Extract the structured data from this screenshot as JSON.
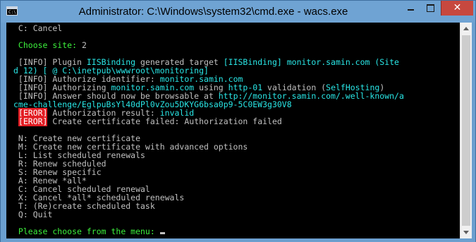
{
  "window": {
    "title": "Administrator: C:\\Windows\\system32\\cmd.exe - wacs.exe",
    "app_icon": "console-icon",
    "controls": {
      "minimize_icon": "minimize-icon",
      "maximize_icon": "maximize-icon",
      "close_icon": "close-icon",
      "close_glyph": "✕"
    }
  },
  "colors": {
    "titlebar": "#6fa3d3",
    "console_bg": "#000000",
    "text": "#c0c0c0",
    "green": "#3cf03c",
    "cyan": "#29e6e6",
    "error_bg": "#e31c23",
    "close_button": "#c7483f"
  },
  "console": {
    "lines": [
      [
        {
          "t": " C: Cancel",
          "c": "w"
        }
      ],
      [
        {
          "t": "",
          "c": "w"
        }
      ],
      [
        {
          "t": " Choose site: ",
          "c": "g"
        },
        {
          "t": "2",
          "c": "w"
        }
      ],
      [
        {
          "t": "",
          "c": "w"
        }
      ],
      [
        {
          "t": " [INFO] Plugin ",
          "c": "w"
        },
        {
          "t": "IISBinding",
          "c": "c"
        },
        {
          "t": " generated target ",
          "c": "w"
        },
        {
          "t": "[IISBinding] monitor.samin.com (Site",
          "c": "c"
        }
      ],
      [
        {
          "t": "d 12) [ @ C:\\inetpub\\wwwroot\\monitoring]",
          "c": "c"
        }
      ],
      [
        {
          "t": " [INFO] Authorize identifier: ",
          "c": "w"
        },
        {
          "t": "monitor.samin.com",
          "c": "c"
        }
      ],
      [
        {
          "t": " [INFO] Authorizing ",
          "c": "w"
        },
        {
          "t": "monitor.samin.com",
          "c": "c"
        },
        {
          "t": " using ",
          "c": "w"
        },
        {
          "t": "http-01",
          "c": "c"
        },
        {
          "t": " validation (",
          "c": "w"
        },
        {
          "t": "SelfHosting",
          "c": "c"
        },
        {
          "t": ")",
          "c": "w"
        }
      ],
      [
        {
          "t": " [INFO] Answer should now be browsable at ",
          "c": "w"
        },
        {
          "t": "http://monitor.samin.com/.well-known/a",
          "c": "c"
        }
      ],
      [
        {
          "t": "cme-challenge/EglpuBsYl40dPl0vZou5DKYG6bsa0p9-5C0EW3g30V8",
          "c": "c"
        }
      ],
      [
        {
          "t": " ",
          "c": "w"
        },
        {
          "t": "[EROR]",
          "c": "err"
        },
        {
          "t": " Authorization result: ",
          "c": "w"
        },
        {
          "t": "invalid",
          "c": "c"
        }
      ],
      [
        {
          "t": " ",
          "c": "w"
        },
        {
          "t": "[EROR]",
          "c": "err"
        },
        {
          "t": " Create certificate failed: Authorization failed",
          "c": "w"
        }
      ],
      [
        {
          "t": "",
          "c": "w"
        }
      ],
      [
        {
          "t": " N: Create new certificate",
          "c": "w"
        }
      ],
      [
        {
          "t": " M: Create new certificate with advanced options",
          "c": "w"
        }
      ],
      [
        {
          "t": " L: List scheduled renewals",
          "c": "w"
        }
      ],
      [
        {
          "t": " R: Renew scheduled",
          "c": "w"
        }
      ],
      [
        {
          "t": " S: Renew specific",
          "c": "w"
        }
      ],
      [
        {
          "t": " A: Renew *all*",
          "c": "w"
        }
      ],
      [
        {
          "t": " C: Cancel scheduled renewal",
          "c": "w"
        }
      ],
      [
        {
          "t": " X: Cancel *all* scheduled renewals",
          "c": "w"
        }
      ],
      [
        {
          "t": " T: (Re)create scheduled task",
          "c": "w"
        }
      ],
      [
        {
          "t": " Q: Quit",
          "c": "w"
        }
      ],
      [
        {
          "t": "",
          "c": "w"
        }
      ],
      [
        {
          "t": " Please choose from the menu: ",
          "c": "g"
        }
      ]
    ]
  },
  "scrollbar": {
    "up_icon": "scroll-up-arrow-icon",
    "down_icon": "scroll-down-arrow-icon"
  }
}
